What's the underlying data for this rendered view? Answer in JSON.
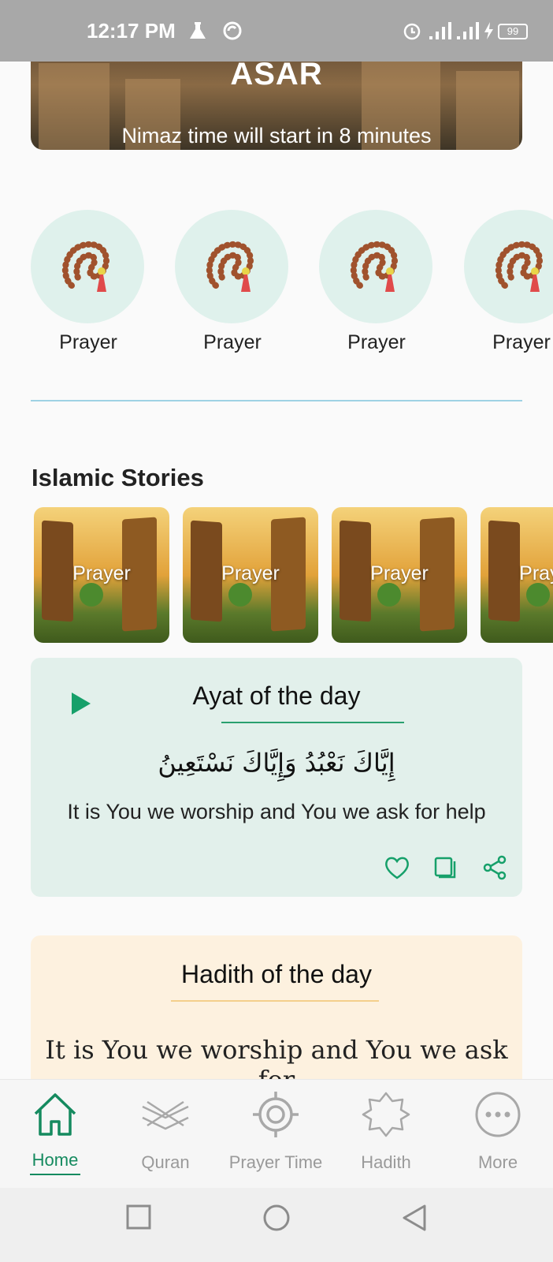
{
  "status_bar": {
    "time": "12:17 PM",
    "battery": "99",
    "icons": [
      "flask-icon",
      "sync-circle-icon",
      "alarm-icon",
      "signal-icon",
      "signal-icon",
      "charging-icon",
      "battery-icon"
    ]
  },
  "hero": {
    "title": "ASAR",
    "subtitle": "Nimaz time will start in 8 minutes"
  },
  "shortcuts": [
    {
      "label": "Prayer",
      "icon": "prayer-beads-icon"
    },
    {
      "label": "Prayer",
      "icon": "prayer-beads-icon"
    },
    {
      "label": "Prayer",
      "icon": "prayer-beads-icon"
    },
    {
      "label": "Prayer",
      "icon": "prayer-beads-icon"
    }
  ],
  "islamic_stories": {
    "title": "Islamic Stories",
    "items": [
      {
        "label": "Prayer"
      },
      {
        "label": "Prayer"
      },
      {
        "label": "Prayer"
      },
      {
        "label": "Prayer"
      }
    ]
  },
  "ayat": {
    "title": "Ayat of the day",
    "arabic": "إِيَّاكَ نَعْبُدُ وَإِيَّاكَ نَسْتَعِينُ",
    "translation": "It is You we worship and You we ask for help",
    "actions": [
      "heart-icon",
      "copy-icon",
      "share-icon"
    ]
  },
  "hadith": {
    "title": "Hadith of the day",
    "text": "It is You we worship and You we ask for"
  },
  "bottom_nav": {
    "items": [
      {
        "label": "Home",
        "icon": "home-icon",
        "active": true
      },
      {
        "label": "Quran",
        "icon": "quran-icon",
        "active": false
      },
      {
        "label": "Prayer Time",
        "icon": "target-icon",
        "active": false
      },
      {
        "label": "Hadith",
        "icon": "star-badge-icon",
        "active": false
      },
      {
        "label": "More",
        "icon": "more-icon",
        "active": false
      }
    ]
  },
  "colors": {
    "accent": "#158a5f",
    "ayat_bg": "#e2f0eb",
    "hadith_bg": "#fdf1df",
    "circle_bg": "#dff1ec"
  }
}
